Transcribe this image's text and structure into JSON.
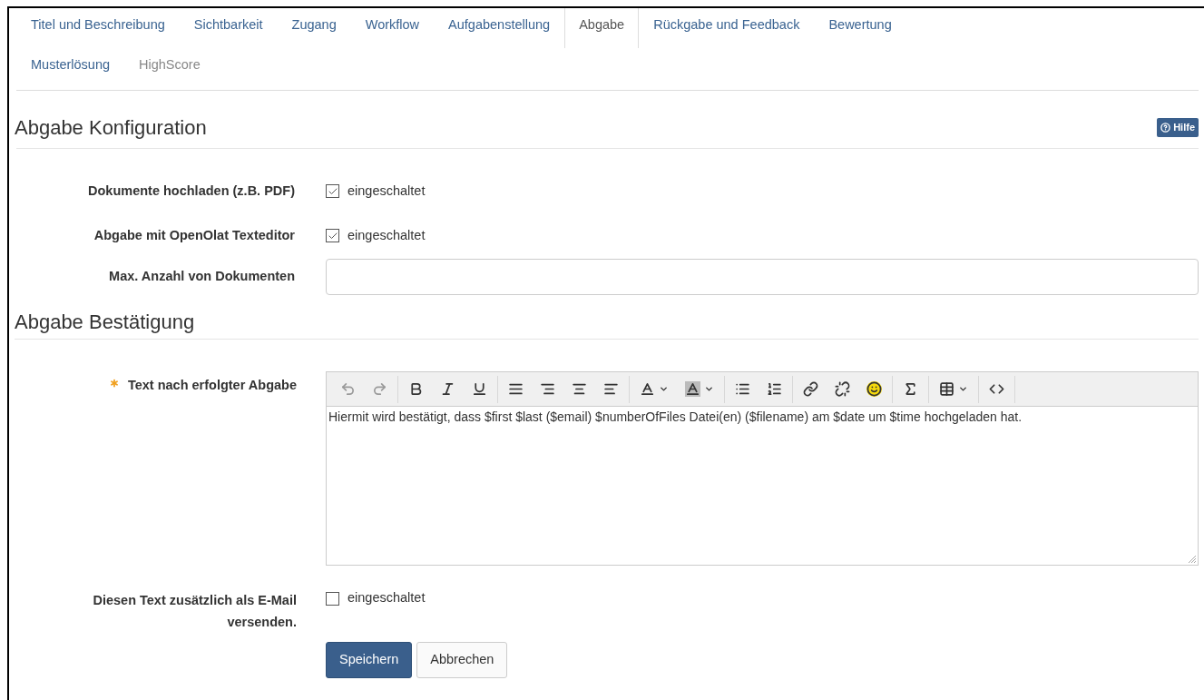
{
  "tabs": [
    {
      "label": "Titel und Beschreibung",
      "selected": false,
      "disabled": false
    },
    {
      "label": "Sichtbarkeit",
      "selected": false,
      "disabled": false
    },
    {
      "label": "Zugang",
      "selected": false,
      "disabled": false
    },
    {
      "label": "Workflow",
      "selected": false,
      "disabled": false
    },
    {
      "label": "Aufgabenstellung",
      "selected": false,
      "disabled": false
    },
    {
      "label": "Abgabe",
      "selected": true,
      "disabled": false
    },
    {
      "label": "Rückgabe und Feedback",
      "selected": false,
      "disabled": false
    },
    {
      "label": "Bewertung",
      "selected": false,
      "disabled": false
    },
    {
      "label": "Musterlösung",
      "selected": false,
      "disabled": false
    },
    {
      "label": "HighScore",
      "selected": false,
      "disabled": true
    }
  ],
  "config": {
    "title": "Abgabe Konfiguration",
    "help_button": "Hilfe",
    "fields": [
      {
        "kind": "checkbox",
        "label": "Dokumente hochladen (z.B. PDF)",
        "option": "eingeschaltet",
        "checked": true
      },
      {
        "kind": "checkbox",
        "label": "Abgabe mit OpenOlat Texteditor",
        "option": "eingeschaltet",
        "checked": true
      },
      {
        "kind": "input",
        "label": "Max. Anzahl von Dokumenten"
      }
    ]
  },
  "confirmation": {
    "title": "Abgabe Bestätigung",
    "editor": {
      "label": "Text nach erfolgter Abgabe",
      "required": true,
      "toolbar": [
        [
          {
            "kind": "undo",
            "disabled": true
          },
          {
            "kind": "redo",
            "disabled": true
          }
        ],
        [
          {
            "kind": "bold",
            "disabled": false
          },
          {
            "kind": "italic",
            "disabled": false
          },
          {
            "kind": "underline",
            "disabled": false
          }
        ],
        [
          {
            "kind": "justify",
            "disabled": false
          },
          {
            "kind": "align-right",
            "disabled": false
          },
          {
            "kind": "align-center",
            "disabled": false
          },
          {
            "kind": "align-left",
            "disabled": false
          }
        ],
        [
          {
            "kind": "text-color",
            "disabled": false
          },
          {
            "kind": "background-color",
            "disabled": false
          }
        ],
        [
          {
            "kind": "bullet-list",
            "disabled": false
          },
          {
            "kind": "numbered-list",
            "disabled": false
          }
        ],
        [
          {
            "kind": "link",
            "disabled": false
          },
          {
            "kind": "unlink",
            "disabled": false
          },
          {
            "kind": "emoji",
            "disabled": false
          }
        ],
        [
          {
            "kind": "formula",
            "disabled": false
          }
        ],
        [
          {
            "kind": "table",
            "disabled": false
          }
        ],
        [
          {
            "kind": "source-code",
            "disabled": false
          }
        ]
      ],
      "content": "Hiermit wird bestätigt, dass $first $last ($email) $numberOfFiles Datei(en) ($filename) am $date um $time hochgeladen hat."
    },
    "email": {
      "label": "Diesen Text zusätzlich als E-Mail versenden.",
      "option": "eingeschaltet",
      "checked": false
    }
  },
  "buttons": [
    {
      "label": "Speichern",
      "kind": "primary"
    },
    {
      "label": "Abbrechen",
      "kind": "default"
    }
  ]
}
